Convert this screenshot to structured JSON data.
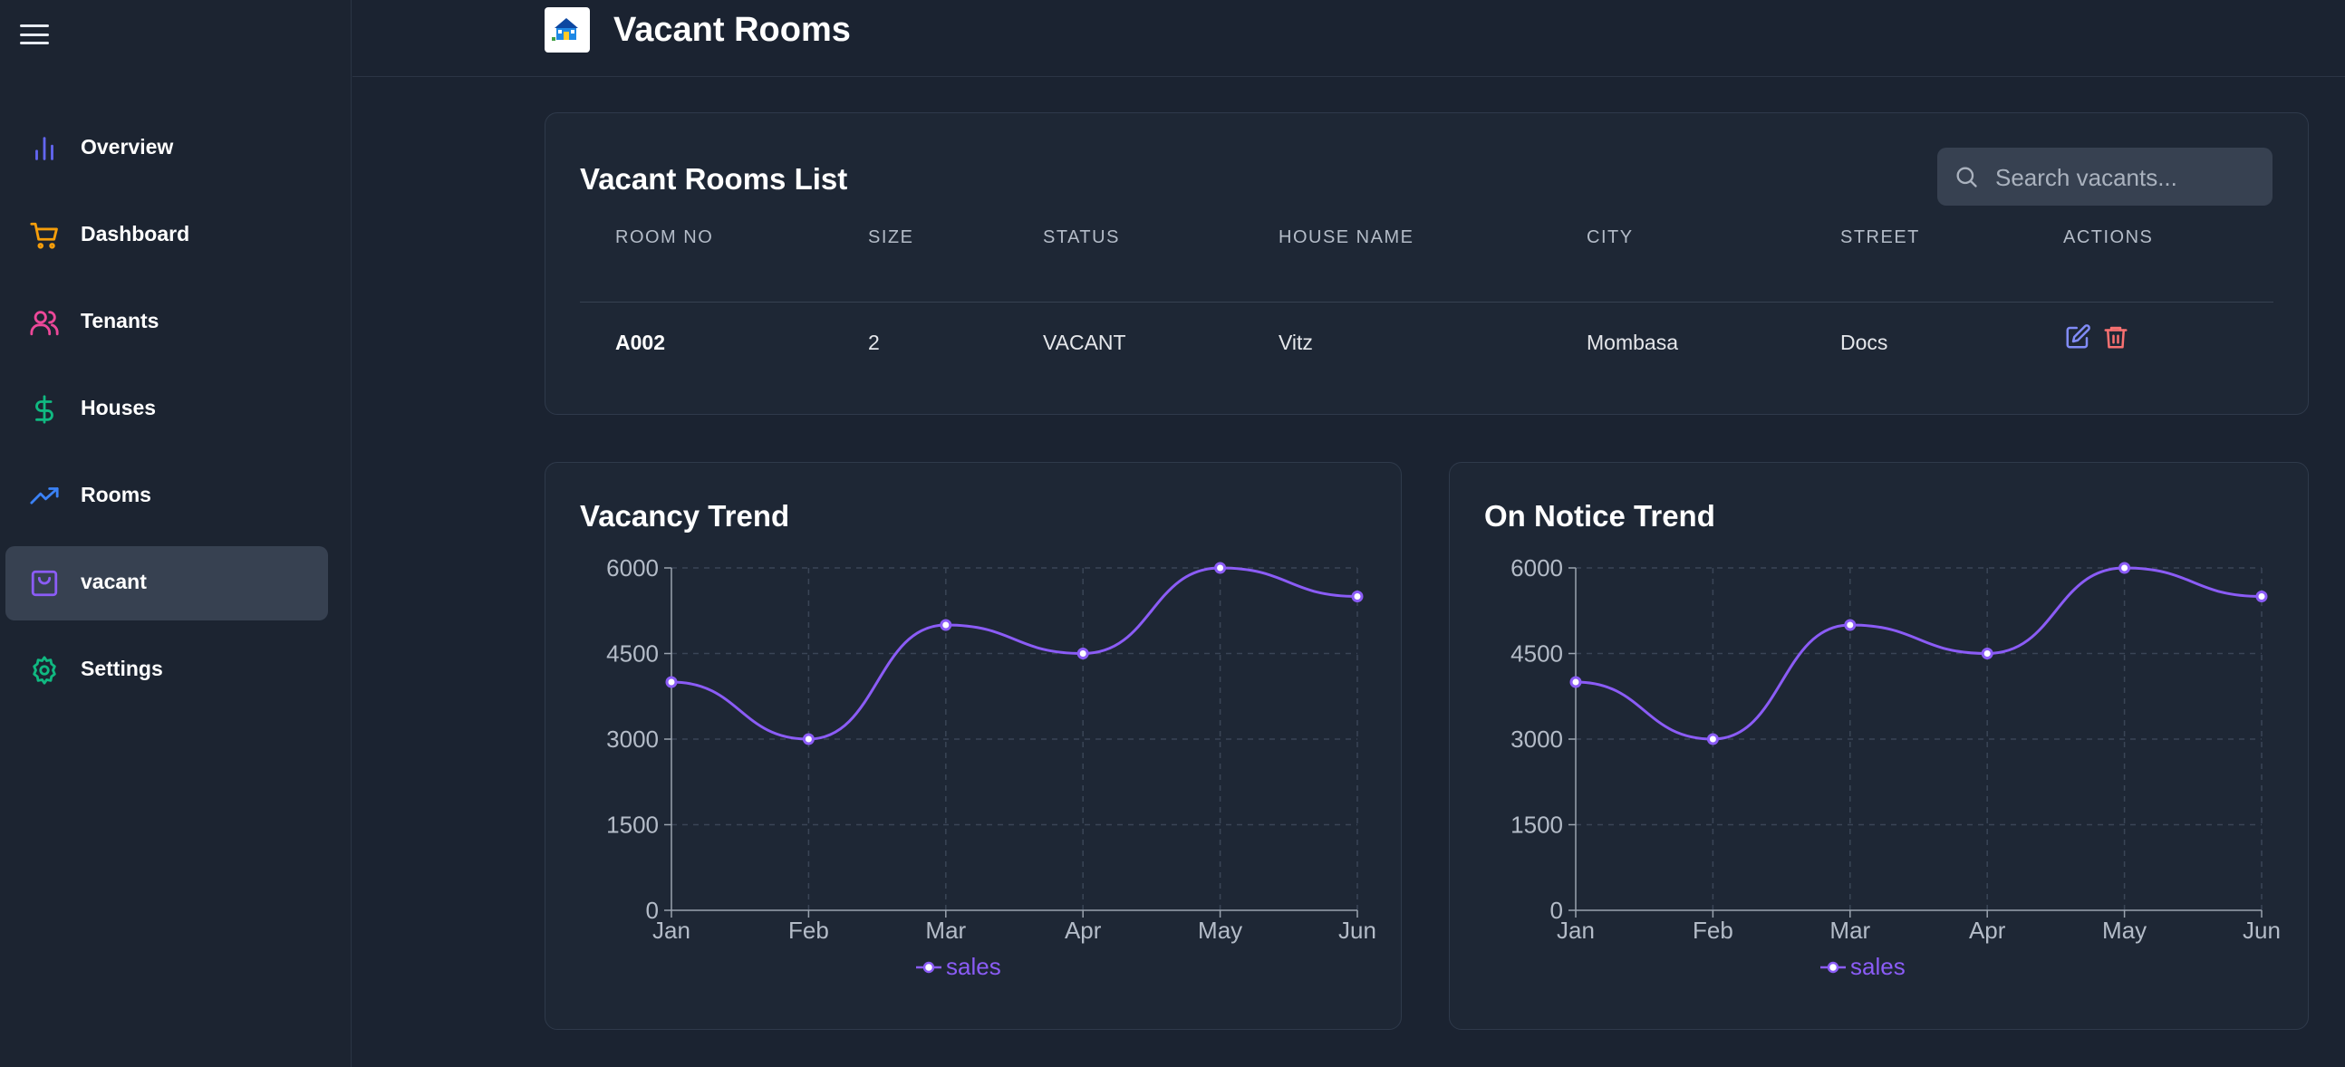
{
  "sidebar": {
    "items": [
      {
        "label": "Overview",
        "icon": "bar-chart-icon",
        "color": "#6366f1"
      },
      {
        "label": "Dashboard",
        "icon": "cart-icon",
        "color": "#f59e0b"
      },
      {
        "label": "Tenants",
        "icon": "users-icon",
        "color": "#ec4899"
      },
      {
        "label": "Houses",
        "icon": "dollar-icon",
        "color": "#10b981"
      },
      {
        "label": "Rooms",
        "icon": "trending-up-icon",
        "color": "#3b82f6"
      },
      {
        "label": "vacant",
        "icon": "shopping-bag-icon",
        "color": "#8b5cf6",
        "active": true
      },
      {
        "label": "Settings",
        "icon": "gear-icon",
        "color": "#10b981"
      }
    ]
  },
  "header": {
    "title": "Vacant Rooms"
  },
  "list": {
    "title": "Vacant Rooms List",
    "search_placeholder": "Search vacants...",
    "columns": [
      "ROOM NO",
      "SIZE",
      "STATUS",
      "HOUSE NAME",
      "CITY",
      "STREET",
      "ACTIONS"
    ],
    "rows": [
      {
        "room_no": "A002",
        "size": "2",
        "status": "VACANT",
        "house_name": "Vitz",
        "city": "Mombasa",
        "street": "Docs"
      }
    ]
  },
  "colors": {
    "line": "#8b5cf6",
    "edit": "#818cf8",
    "delete": "#f87171"
  },
  "chart_data": [
    {
      "type": "line",
      "title": "Vacancy Trend",
      "categories": [
        "Jan",
        "Feb",
        "Mar",
        "Apr",
        "May",
        "Jun"
      ],
      "series": [
        {
          "name": "sales",
          "values": [
            4000,
            3000,
            5000,
            4500,
            6000,
            5500
          ]
        }
      ],
      "ylim": [
        0,
        6000
      ],
      "yticks": [
        0,
        1500,
        3000,
        4500,
        6000
      ],
      "grid": true,
      "legend": "bottom"
    },
    {
      "type": "line",
      "title": "On Notice Trend",
      "categories": [
        "Jan",
        "Feb",
        "Mar",
        "Apr",
        "May",
        "Jun"
      ],
      "series": [
        {
          "name": "sales",
          "values": [
            4000,
            3000,
            5000,
            4500,
            6000,
            5500
          ]
        }
      ],
      "ylim": [
        0,
        6000
      ],
      "yticks": [
        0,
        1500,
        3000,
        4500,
        6000
      ],
      "grid": true,
      "legend": "bottom"
    }
  ]
}
